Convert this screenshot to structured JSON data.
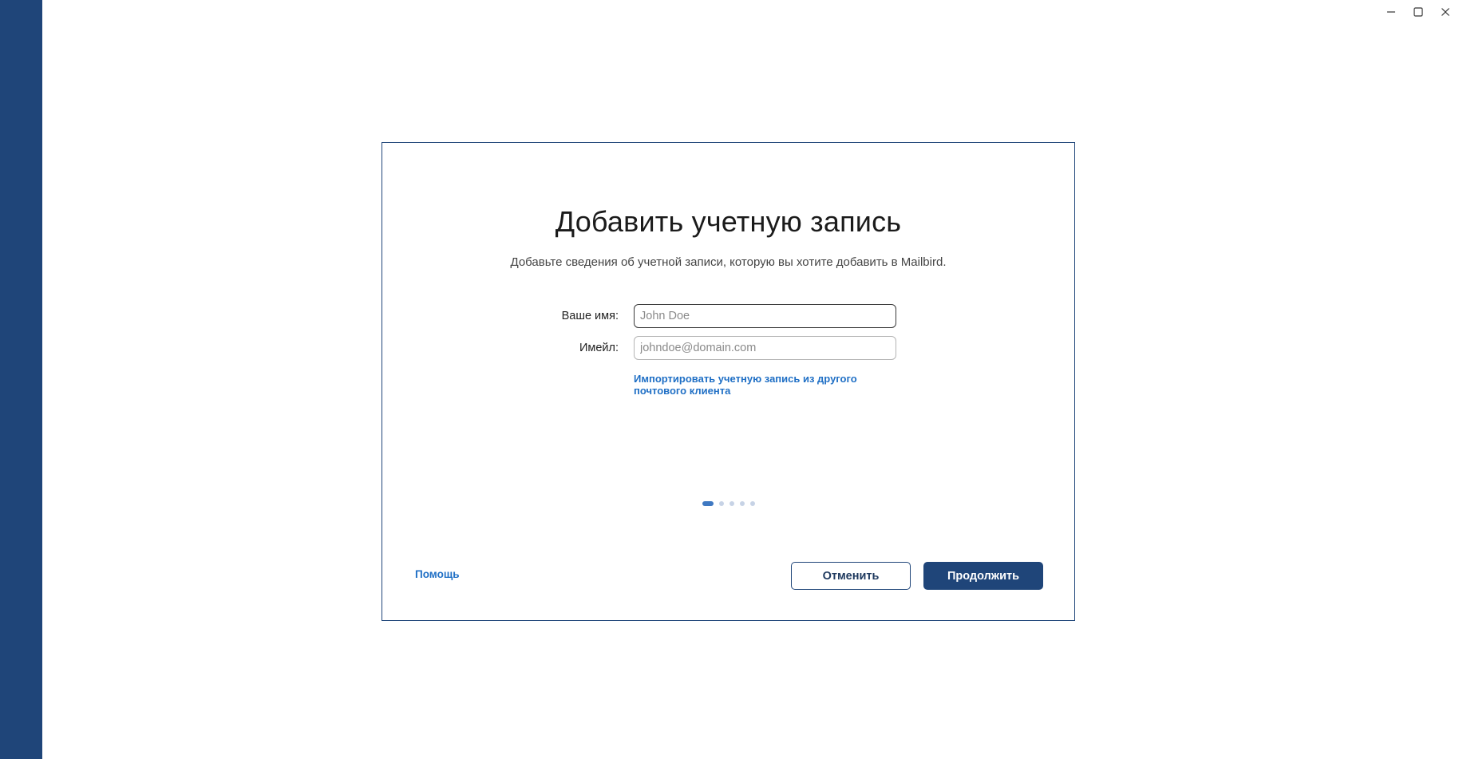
{
  "window": {
    "controls": {
      "minimize_icon": "minimize-icon",
      "maximize_icon": "maximize-icon",
      "close_icon": "close-icon"
    }
  },
  "dialog": {
    "title": "Добавить учетную запись",
    "subtitle": "Добавьте сведения об учетной записи, которую вы хотите добавить в Mailbird.",
    "fields": {
      "name": {
        "label": "Ваше имя:",
        "placeholder": "John Doe",
        "value": ""
      },
      "email": {
        "label": "Имейл:",
        "placeholder": "johndoe@domain.com",
        "value": ""
      }
    },
    "import_link_line1": "Импортировать учетную запись из другого",
    "import_link_line2": "почтового клиента",
    "steps": {
      "total": 5,
      "current": 1
    },
    "help_label": "Помощь",
    "cancel_label": "Отменить",
    "continue_label": "Продолжить"
  },
  "colors": {
    "sidebar": "#1f4579",
    "primary_button": "#1f4579",
    "link": "#1f6fc5",
    "active_dot": "#3f79c2",
    "inactive_dot": "#c7d3e6"
  }
}
